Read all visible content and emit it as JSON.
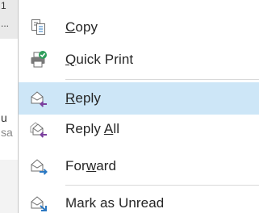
{
  "background_window": {
    "lines": [
      {
        "text": "1"
      },
      {
        "text": "..."
      },
      {
        "text": "u"
      },
      {
        "text": "sa"
      }
    ]
  },
  "context_menu": {
    "items": [
      {
        "pre": "",
        "mnemonic": "C",
        "post": "opy",
        "icon": "copy-icon"
      },
      {
        "pre": "",
        "mnemonic": "Q",
        "post": "uick Print",
        "icon": "quick-print-icon"
      },
      {
        "pre": "",
        "mnemonic": "R",
        "post": "eply",
        "icon": "reply-icon",
        "highlighted": true
      },
      {
        "pre": "Reply ",
        "mnemonic": "A",
        "post": "ll",
        "icon": "reply-all-icon"
      },
      {
        "pre": "For",
        "mnemonic": "w",
        "post": "ard",
        "icon": "forward-icon"
      },
      {
        "pre": "Mark as Unread",
        "mnemonic": "",
        "post": "",
        "icon": "mark-unread-icon"
      }
    ]
  },
  "colors": {
    "highlight": "#cde6f7",
    "accent_purple": "#7b3f9e",
    "accent_blue": "#2b78c2",
    "accent_green": "#2e9e5b",
    "icon_gray": "#6d6d6d"
  }
}
